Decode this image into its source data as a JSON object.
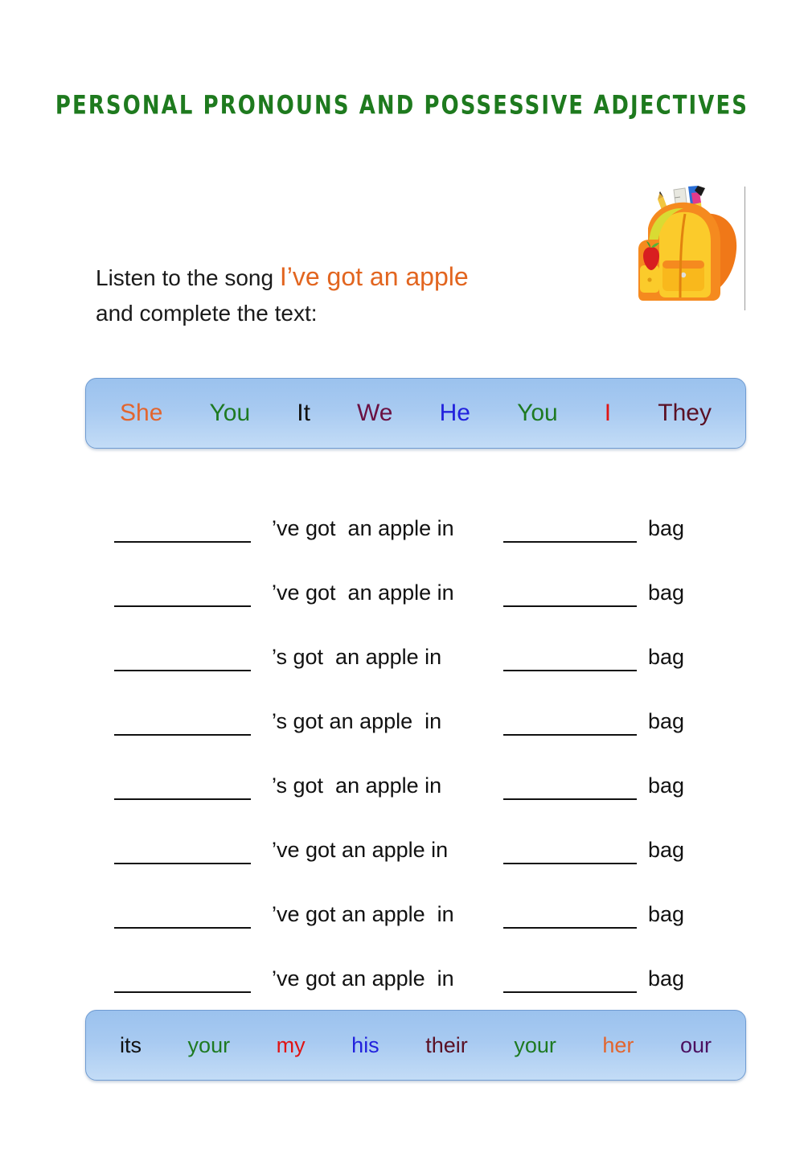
{
  "title": "PERSONAL PRONOUNS AND POSSESSIVE ADJECTIVES",
  "title_color": "#1E7A1E",
  "instruction": {
    "lead": "Listen to the song ",
    "song": "I’ve got an apple",
    "song_color": "#E2651F",
    "second_line": "and complete the text:"
  },
  "illustration": {
    "name": "backpack-with-school-supplies",
    "items": [
      "backpack",
      "pencil",
      "ruler",
      "pen",
      "apple"
    ]
  },
  "pronoun_bank": {
    "words": [
      {
        "text": "She",
        "color": "#E2652E"
      },
      {
        "text": "You",
        "color": "#1E7A22"
      },
      {
        "text": "It",
        "color": "#111111"
      },
      {
        "text": "We",
        "color": "#6B1142"
      },
      {
        "text": "He",
        "color": "#2222DD"
      },
      {
        "text": "You",
        "color": "#1E7A22"
      },
      {
        "text": "I",
        "color": "#E01414"
      },
      {
        "text": "They",
        "color": "#5A1024"
      }
    ]
  },
  "possessive_bank": {
    "words": [
      {
        "text": "its",
        "color": "#111111"
      },
      {
        "text": "your",
        "color": "#1E7A22"
      },
      {
        "text": "my",
        "color": "#E01414"
      },
      {
        "text": "his",
        "color": "#2222DD"
      },
      {
        "text": "their",
        "color": "#5A1024"
      },
      {
        "text": "your",
        "color": "#1E7A22"
      },
      {
        "text": "her",
        "color": "#E2652E"
      },
      {
        "text": "our",
        "color": "#4B1060"
      }
    ]
  },
  "sentences": [
    {
      "middle": "’ve got  an apple in",
      "tail": "bag"
    },
    {
      "middle": "’ve got  an apple in",
      "tail": "bag"
    },
    {
      "middle": "’s got  an apple in",
      "tail": "bag"
    },
    {
      "middle": "’s got an apple  in",
      "tail": "bag"
    },
    {
      "middle": "’s got  an apple in",
      "tail": "bag"
    },
    {
      "middle": "’ve got an apple in",
      "tail": "bag"
    },
    {
      "middle": "’ve got an apple  in",
      "tail": "bag"
    },
    {
      "middle": "’ve got an apple  in",
      "tail": "bag"
    }
  ],
  "bank_style": {
    "border_color": "#6F9BD1",
    "gradient_top": "#9BC2EE",
    "gradient_bottom": "#C3DCF6"
  }
}
